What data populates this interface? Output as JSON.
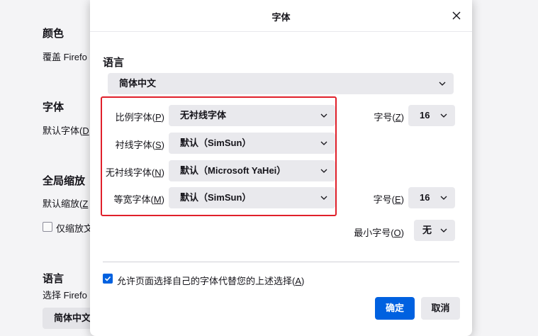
{
  "background": {
    "color_heading": "颜色",
    "color_text": "覆盖 Firefo",
    "fonts_heading": "字体",
    "fonts_text_prefix": "默认字体(",
    "fonts_text_key": "D",
    "zoom_heading": "全局缩放",
    "zoom_text_prefix": "默认缩放(",
    "zoom_text_key": "Z",
    "zoom_checkbox_label": "仅缩放文",
    "lang_heading": "语言",
    "lang_text": "选择 Firefo",
    "lang_select": "简体中文"
  },
  "dialog": {
    "title": "字体",
    "section_label": "语言",
    "language_value": "简体中文",
    "rows": [
      {
        "label": "比例字体(",
        "key": "P",
        "value": "无衬线字体"
      },
      {
        "label": "衬线字体(",
        "key": "S",
        "value": "默认（SimSun）"
      },
      {
        "label": "无衬线字体(",
        "key": "N",
        "value": "默认（Microsoft YaHei）"
      },
      {
        "label": "等宽字体(",
        "key": "M",
        "value": "默认（SimSun）"
      }
    ],
    "size_proportional": {
      "label": "字号(",
      "key": "Z",
      "value": "16"
    },
    "size_monospace": {
      "label": "字号(",
      "key": "E",
      "value": "16"
    },
    "min_size": {
      "label": "最小字号(",
      "key": "O",
      "value": "无"
    },
    "allow_pages_label": "允许页面选择自己的字体代替您的上述选择(",
    "allow_pages_key": "A",
    "allow_pages_checked": true,
    "ok_label": "确定",
    "cancel_label": "取消"
  },
  "icons": {
    "close": "close-icon",
    "chevron": "chevron-down-icon",
    "check": "checkmark-icon"
  },
  "colors": {
    "accent": "#0061e0",
    "highlight_box": "#e0202a",
    "select_bg": "#e9e9ed"
  }
}
